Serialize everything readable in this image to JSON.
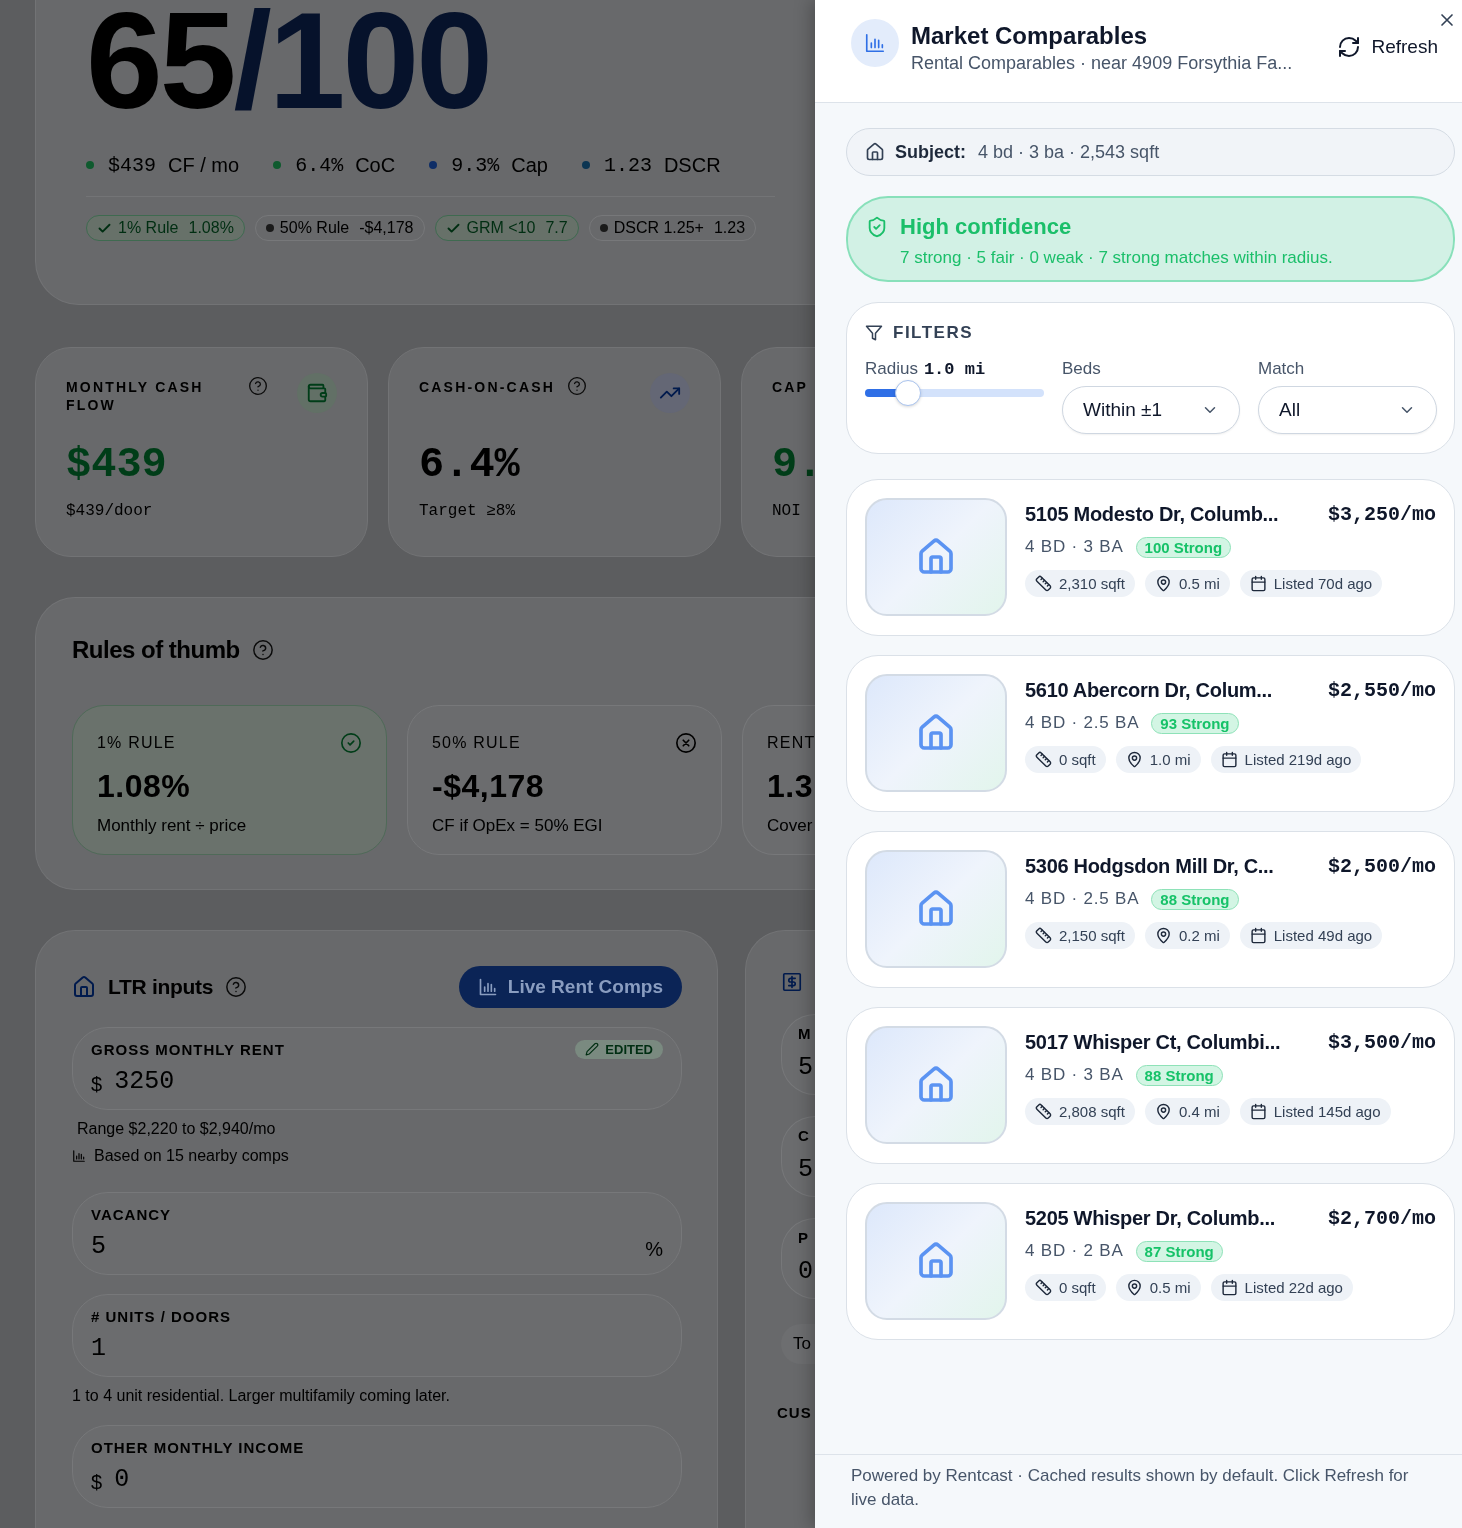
{
  "background_page": {
    "score": {
      "value": "65",
      "total": "/100"
    },
    "metrics": [
      {
        "value": "$439",
        "label": "CF / mo",
        "color": "#0f5a2e"
      },
      {
        "value": "6.4%",
        "label": "CoC",
        "color": "#0f5a2e"
      },
      {
        "value": "9.3%",
        "label": "Cap",
        "color": "#0e2d66"
      },
      {
        "value": "1.23",
        "label": "DSCR",
        "color": "#0c3552"
      }
    ],
    "rule_pills": [
      {
        "label": "1% Rule",
        "value": "1.08%",
        "kind": "pass"
      },
      {
        "label": "50% Rule",
        "value": "-$4,178",
        "kind": "neutral"
      },
      {
        "label": "GRM <10",
        "value": "7.7",
        "kind": "pass"
      },
      {
        "label": "DSCR 1.25+",
        "value": "1.23",
        "kind": "neutral"
      }
    ],
    "kpi_cards": [
      {
        "label": "MONTHLY CASH FLOW",
        "value": "$439",
        "sub": "$439/door",
        "kind": "positive"
      },
      {
        "label": "CASH-ON-CASH",
        "value": "6.4%",
        "sub": "Target ≥8%",
        "kind": "neutral"
      },
      {
        "label": "CAP",
        "value": "9.",
        "sub": "NOI",
        "kind": "partial"
      }
    ],
    "rules_of_thumb": {
      "title": "Rules of thumb",
      "cards": [
        {
          "label": "1% RULE",
          "value": "1.08%",
          "note": "Monthly rent ÷ price",
          "kind": "pass"
        },
        {
          "label": "50% RULE",
          "value": "-$4,178",
          "note": "CF if OpEx = 50% EGI",
          "kind": "fail"
        },
        {
          "label": "RENT",
          "value": "1.3",
          "note": "Cover",
          "kind": "partial"
        }
      ]
    },
    "ltr_inputs": {
      "title": "LTR inputs",
      "button": "Live Rent Comps",
      "items": [
        {
          "kind": "field",
          "label": "GROSS MONTHLY RENT",
          "prefix": "$",
          "value": "3250",
          "badge": "EDITED"
        },
        {
          "kind": "note",
          "text": "Range $2,220 to $2,940/mo"
        },
        {
          "kind": "source",
          "text": "Based on 15 nearby comps"
        },
        {
          "kind": "field",
          "label": "VACANCY",
          "value": "5",
          "suffix": "%"
        },
        {
          "kind": "field",
          "label": "# UNITS / DOORS",
          "value": "1"
        },
        {
          "kind": "note",
          "text": "1 to 4 unit residential. Larger multifamily coming later."
        },
        {
          "kind": "field",
          "label": "OTHER MONTHLY INCOME",
          "prefix": "$",
          "value": "0"
        }
      ]
    },
    "side_card": {
      "fields": [
        {
          "label": "M",
          "value": "5"
        },
        {
          "label": "C",
          "value": "5"
        },
        {
          "label": "P",
          "value": "0"
        }
      ],
      "text": "To",
      "section": "CUS"
    }
  },
  "drawer": {
    "title": "Market Comparables",
    "subtitle": "Rental Comparables · near 4909 Forsythia Fa...",
    "refresh": "Refresh",
    "subject": {
      "label": "Subject:",
      "value": "4 bd · 3 ba · 2,543 sqft"
    },
    "confidence": {
      "kind": "high",
      "title": "High confidence",
      "detail": "7 strong · 5 fair · 0 weak · 7 strong matches within radius."
    },
    "filters": {
      "title": "FILTERS",
      "radius": {
        "label": "Radius",
        "value": "1.0 mi",
        "level": 0.24
      },
      "selects": [
        {
          "label": "Beds",
          "value": "Within ±1"
        },
        {
          "label": "Match",
          "value": "All"
        }
      ]
    },
    "comps": [
      {
        "address": "5105 Modesto Dr, Columb...",
        "rent": "$3,250/mo",
        "beds_baths": "4 BD · 3 BA",
        "match": "100 Strong",
        "sqft": "2,310 sqft",
        "distance": "0.5 mi",
        "listed": "Listed 70d ago"
      },
      {
        "address": "5610 Abercorn Dr, Colum...",
        "rent": "$2,550/mo",
        "beds_baths": "4 BD · 2.5 BA",
        "match": "93 Strong",
        "sqft": "0 sqft",
        "distance": "1.0 mi",
        "listed": "Listed 219d ago"
      },
      {
        "address": "5306 Hodgsdon Mill Dr, C...",
        "rent": "$2,500/mo",
        "beds_baths": "4 BD · 2.5 BA",
        "match": "88 Strong",
        "sqft": "2,150 sqft",
        "distance": "0.2 mi",
        "listed": "Listed 49d ago"
      },
      {
        "address": "5017 Whisper Ct, Columbi...",
        "rent": "$3,500/mo",
        "beds_baths": "4 BD · 3 BA",
        "match": "88 Strong",
        "sqft": "2,808 sqft",
        "distance": "0.4 mi",
        "listed": "Listed 145d ago"
      },
      {
        "address": "5205 Whisper Dr, Columb...",
        "rent": "$2,700/mo",
        "beds_baths": "4 BD · 2 BA",
        "match": "87 Strong",
        "sqft": "0 sqft",
        "distance": "0.5 mi",
        "listed": "Listed 22d ago"
      }
    ],
    "footer": "Powered by Rentcast · Cached results shown by default. Click Refresh for live data."
  }
}
